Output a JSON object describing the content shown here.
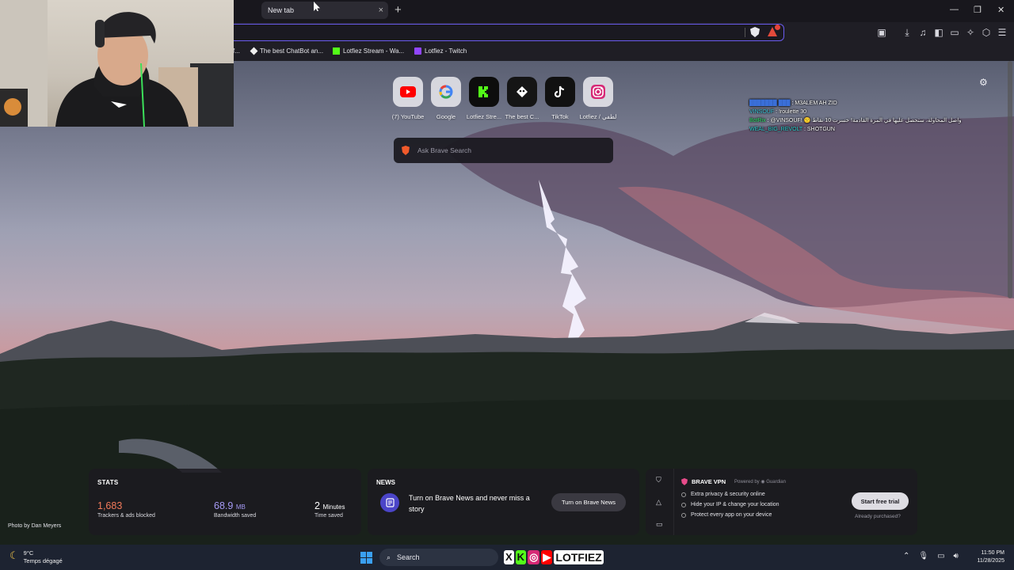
{
  "browser": {
    "active_tab": "New tab",
    "close_symbol": "×",
    "new_tab_symbol": "+",
    "window_controls": [
      "—",
      "❐",
      "✕"
    ]
  },
  "bookmarks": [
    {
      "label": "f...",
      "icon": "folder-icon"
    },
    {
      "label": "The best ChatBot an...",
      "icon": "chatbot-icon"
    },
    {
      "label": "Lotfiez Stream - Wa...",
      "icon": "kick-icon"
    },
    {
      "label": "Lotfiez - Twitch",
      "icon": "twitch-icon"
    }
  ],
  "top_sites": [
    {
      "label": "(7) YouTube",
      "icon": "youtube-icon"
    },
    {
      "label": "Google",
      "icon": "google-icon"
    },
    {
      "label": "Lotfiez Stre...",
      "icon": "kick-icon"
    },
    {
      "label": "The best C...",
      "icon": "chatbot-icon"
    },
    {
      "label": "TikTok",
      "icon": "tiktok-icon"
    },
    {
      "label": "Lotfiez / لطفي",
      "icon": "instagram-icon"
    }
  ],
  "search": {
    "placeholder": "Ask Brave Search"
  },
  "chat": [
    {
      "user": "███████ ███",
      "message": ": M3ALEM AH ZID"
    },
    {
      "user": "VINSOUF",
      "message": ": !roulette 30"
    },
    {
      "user": "BotRix",
      "message": ": @VINSOUF! 🙁 واصل المحاولة، ستحصل عليها في المرة القادمة! خسرت 10 نقاط"
    },
    {
      "user": "WEAL_BIG_REVOLT",
      "message": ": SHOTGUN"
    }
  ],
  "photo_credit": "Photo by Dan Meyers",
  "stats": {
    "header": "STATS",
    "trackers": {
      "value": "1,683",
      "caption": "Trackers & ads blocked"
    },
    "bandwidth": {
      "value": "68.9",
      "unit": "MB",
      "caption": "Bandwidth saved"
    },
    "time": {
      "value": "2",
      "unit": "Minutes",
      "caption": "Time saved"
    }
  },
  "news": {
    "header": "NEWS",
    "text": "Turn on Brave News and never miss a story",
    "button": "Turn on Brave News"
  },
  "vpn": {
    "title": "BRAVE VPN",
    "powered": "Powered by ◉ Guardian",
    "features": [
      "Extra privacy & security online",
      "Hide your IP & change your location",
      "Protect every app on your device"
    ],
    "cta": "Start free trial",
    "purchased": "Already purchased?"
  },
  "taskbar": {
    "temp": "9°C",
    "weather": "Temps dégagé",
    "search": "Search",
    "banner": [
      "X",
      "K",
      "◎",
      "▶",
      "LOTFIEZ"
    ],
    "time": "11:50 PM",
    "date": "11/28/2025"
  },
  "colors": {
    "accent": "#6b5cf0",
    "brave_orange": "#f15a2b",
    "youtube": "#ff0000",
    "kick": "#53fc18"
  }
}
